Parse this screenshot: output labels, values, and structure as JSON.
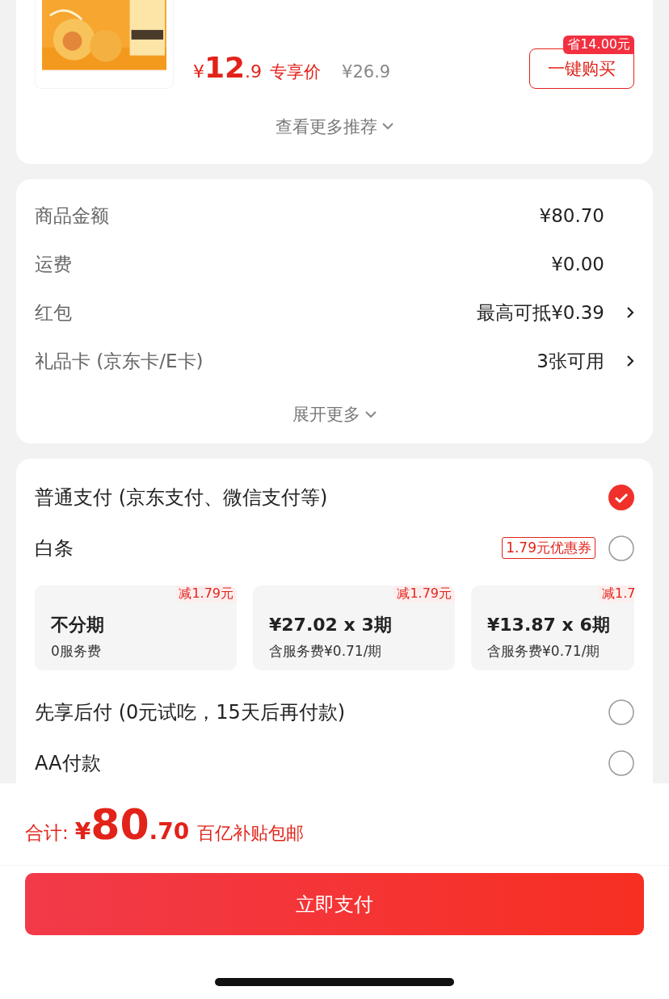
{
  "product": {
    "currency": "¥",
    "price_int": "12",
    "price_dec": ".9",
    "price_label": "专享价",
    "original_price": "¥26.9",
    "save_badge": "省14.00元",
    "buy_button": "一键购买"
  },
  "more_recommend": "查看更多推荐",
  "summary": {
    "rows": [
      {
        "label": "商品金额",
        "value": "¥80.70",
        "arrow": false
      },
      {
        "label": "运费",
        "value": "¥0.00",
        "arrow": false
      },
      {
        "label": "红包",
        "value": "最高可抵¥0.39",
        "arrow": true
      },
      {
        "label": "礼品卡 (京东卡/E卡)",
        "value": "3张可用",
        "arrow": true
      }
    ],
    "expand": "展开更多"
  },
  "payment": {
    "methods": [
      {
        "kind": "option",
        "label": "普通支付 (京东支付、微信支付等)",
        "selected": true
      },
      {
        "kind": "baitiao",
        "label": "白条",
        "coupon": "1.79元优惠券",
        "selected": false,
        "plans": [
          {
            "discount": "减1.79元",
            "title": "不分期",
            "subtitle": "0服务费"
          },
          {
            "discount": "减1.79元",
            "title": "¥27.02 x 3期",
            "subtitle": "含服务费¥0.71/期"
          },
          {
            "discount": "减1.7",
            "title": "¥13.87 x 6期",
            "subtitle": "含服务费¥0.71/期"
          }
        ]
      },
      {
        "kind": "option",
        "label": "先享后付 (0元试吃，15天后再付款)",
        "selected": false
      },
      {
        "kind": "option",
        "label": "AA付款",
        "selected": false
      }
    ]
  },
  "total": {
    "label": "合计:",
    "currency": "¥",
    "int": "80",
    "dec": ".70",
    "note": "百亿补贴包邮"
  },
  "pay_button": "立即支付"
}
